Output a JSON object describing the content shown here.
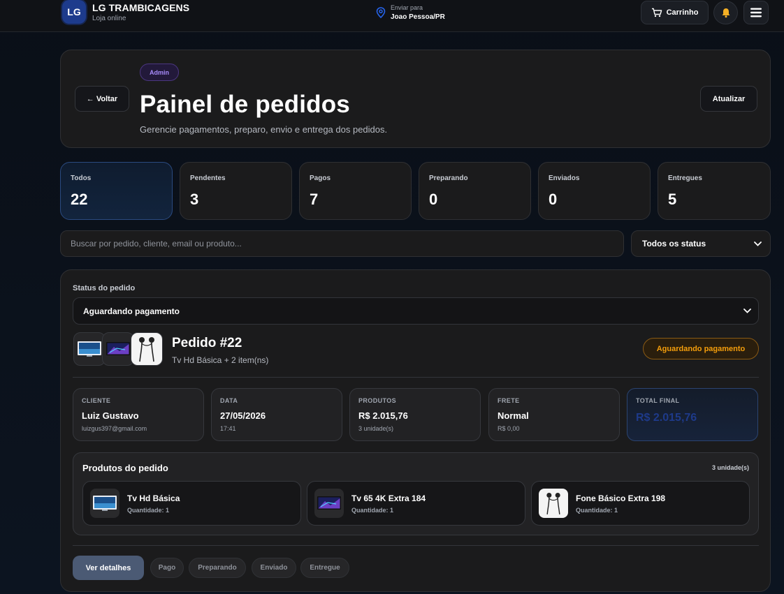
{
  "topbar": {
    "logo": "LG",
    "brand_name": "LG TRAMBICAGENS",
    "brand_sub": "Loja online",
    "ship_label": "Enviar para",
    "ship_city": "Joao Pessoa/PR",
    "cart_label": "Carrinho",
    "icons": [
      "location-pin-icon",
      "cart-icon",
      "bell-icon",
      "menu-icon"
    ]
  },
  "header": {
    "back_label": "← Voltar",
    "badge": "Admin",
    "title": "Painel de pedidos",
    "subtitle": "Gerencie pagamentos, preparo, envio e entrega dos pedidos.",
    "refresh_label": "Atualizar"
  },
  "stats": [
    {
      "label": "Todos",
      "value": "22",
      "active": true
    },
    {
      "label": "Pendentes",
      "value": "3"
    },
    {
      "label": "Pagos",
      "value": "7"
    },
    {
      "label": "Preparando",
      "value": "0"
    },
    {
      "label": "Enviados",
      "value": "0"
    },
    {
      "label": "Entregues",
      "value": "5"
    }
  ],
  "search": {
    "placeholder": "Buscar por pedido, cliente, email ou produto...",
    "value": ""
  },
  "status_filter": {
    "selected": "Todos os status"
  },
  "order": {
    "status_label": "Status do pedido",
    "status_selected": "Aguardando pagamento",
    "title": "Pedido #22",
    "items_summary": "Tv Hd Básica + 2 item(ns)",
    "status_pill": "Aguardando pagamento",
    "info": {
      "client": {
        "label": "CLIENTE",
        "value": "Luiz Gustavo",
        "sub": "luizgus397@gmail.com"
      },
      "date": {
        "label": "DATA",
        "value": "27/05/2026",
        "sub": "17:41"
      },
      "products": {
        "label": "PRODUTOS",
        "value": "R$ 2.015,76",
        "sub": "3 unidade(s)"
      },
      "shipping": {
        "label": "FRETE",
        "value": "Normal",
        "sub": "R$ 0,00"
      },
      "total": {
        "label": "TOTAL FINAL",
        "value": "R$ 2.015,76"
      }
    },
    "products_title": "Produtos do pedido",
    "products_count": "3 unidade(s)",
    "products": [
      {
        "name": "Tv Hd Básica",
        "qty": "Quantidade: 1",
        "icon": "tv-icon"
      },
      {
        "name": "Tv 65 4K Extra 184",
        "qty": "Quantidade: 1",
        "icon": "tv-icon"
      },
      {
        "name": "Fone Básico Extra 198",
        "qty": "Quantidade: 1",
        "icon": "earphones-icon"
      }
    ],
    "actions": {
      "details": "Ver detalhes",
      "paid": "Pago",
      "preparing": "Preparando",
      "shipped": "Enviado",
      "delivered": "Entregue"
    }
  },
  "colors": {
    "accent_blue": "#1d3b8c",
    "admin_purple": "#a78bfa",
    "pending_orange": "#f59e0b",
    "total_value": "#1e3a8a",
    "primary_button": "#4b5a74"
  }
}
